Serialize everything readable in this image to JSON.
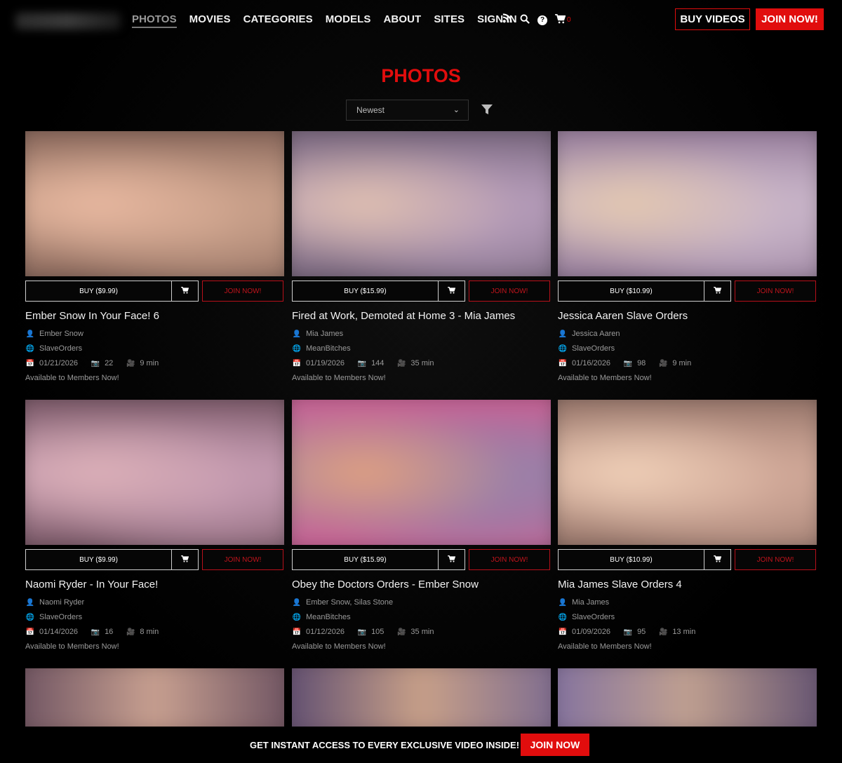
{
  "nav": {
    "items": [
      "PHOTOS",
      "MOVIES",
      "CATEGORIES",
      "MODELS",
      "ABOUT",
      "SITES",
      "SIGN IN"
    ],
    "cart_count": "0",
    "buy_videos_label": "BUY VIDEOS",
    "join_label": "JOIN NOW!"
  },
  "page": {
    "title": "PHOTOS",
    "sort": {
      "selected": "Newest"
    }
  },
  "cards": [
    {
      "title": "Ember Snow In Your Face! 6",
      "models": "Ember Snow",
      "site": "SlaveOrders",
      "date": "01/21/2026",
      "photos": "22",
      "duration": "9 min",
      "status": "Available to Members Now!",
      "buy_label": "BUY ($9.99)",
      "join_label": "JOIN NOW!",
      "tint": [
        "#c9a08a",
        "#e8b8a0",
        "#7a5a50"
      ]
    },
    {
      "title": "Fired at Work, Demoted at Home 3 - Mia James",
      "models": "Mia James",
      "site": "MeanBitches",
      "date": "01/19/2026",
      "photos": "144",
      "duration": "35 min",
      "status": "Available to Members Now!",
      "buy_label": "BUY ($15.99)",
      "join_label": "JOIN NOW!",
      "tint": [
        "#b49bb8",
        "#e0c0b0",
        "#6a5a70"
      ]
    },
    {
      "title": "Jessica Aaren Slave Orders",
      "models": "Jessica Aaren",
      "site": "SlaveOrders",
      "date": "01/16/2026",
      "photos": "98",
      "duration": "9 min",
      "status": "Available to Members Now!",
      "buy_label": "BUY ($10.99)",
      "join_label": "JOIN NOW!",
      "tint": [
        "#c8b4c8",
        "#e4c8b0",
        "#8a7090"
      ]
    },
    {
      "title": "Naomi Ryder - In Your Face!",
      "models": "Naomi Ryder",
      "site": "SlaveOrders",
      "date": "01/14/2026",
      "photos": "16",
      "duration": "8 min",
      "status": "Available to Members Now!",
      "buy_label": "BUY ($9.99)",
      "join_label": "JOIN NOW!",
      "tint": [
        "#c49ab0",
        "#dcb0b8",
        "#6a4a58"
      ]
    },
    {
      "title": "Obey the Doctors Orders - Ember Snow",
      "models": "Ember Snow, Silas Stone",
      "site": "MeanBitches",
      "date": "01/12/2026",
      "photos": "105",
      "duration": "35 min",
      "status": "Available to Members Now!",
      "buy_label": "BUY ($15.99)",
      "join_label": "JOIN NOW!",
      "tint": [
        "#9a80a8",
        "#e0a080",
        "#d05a90"
      ]
    },
    {
      "title": "Mia James Slave Orders 4",
      "models": "Mia James",
      "site": "SlaveOrders",
      "date": "01/09/2026",
      "photos": "95",
      "duration": "13 min",
      "status": "Available to Members Now!",
      "buy_label": "BUY ($10.99)",
      "join_label": "JOIN NOW!",
      "tint": [
        "#d0a898",
        "#f0d0b8",
        "#8a6a60"
      ]
    }
  ],
  "bottom_bar": {
    "text": "GET INSTANT ACCESS TO EVERY EXCLUSIVE VIDEO INSIDE!",
    "join_label": "JOIN NOW"
  },
  "colors": {
    "accent": "#e10d0d",
    "background": "#050505"
  }
}
